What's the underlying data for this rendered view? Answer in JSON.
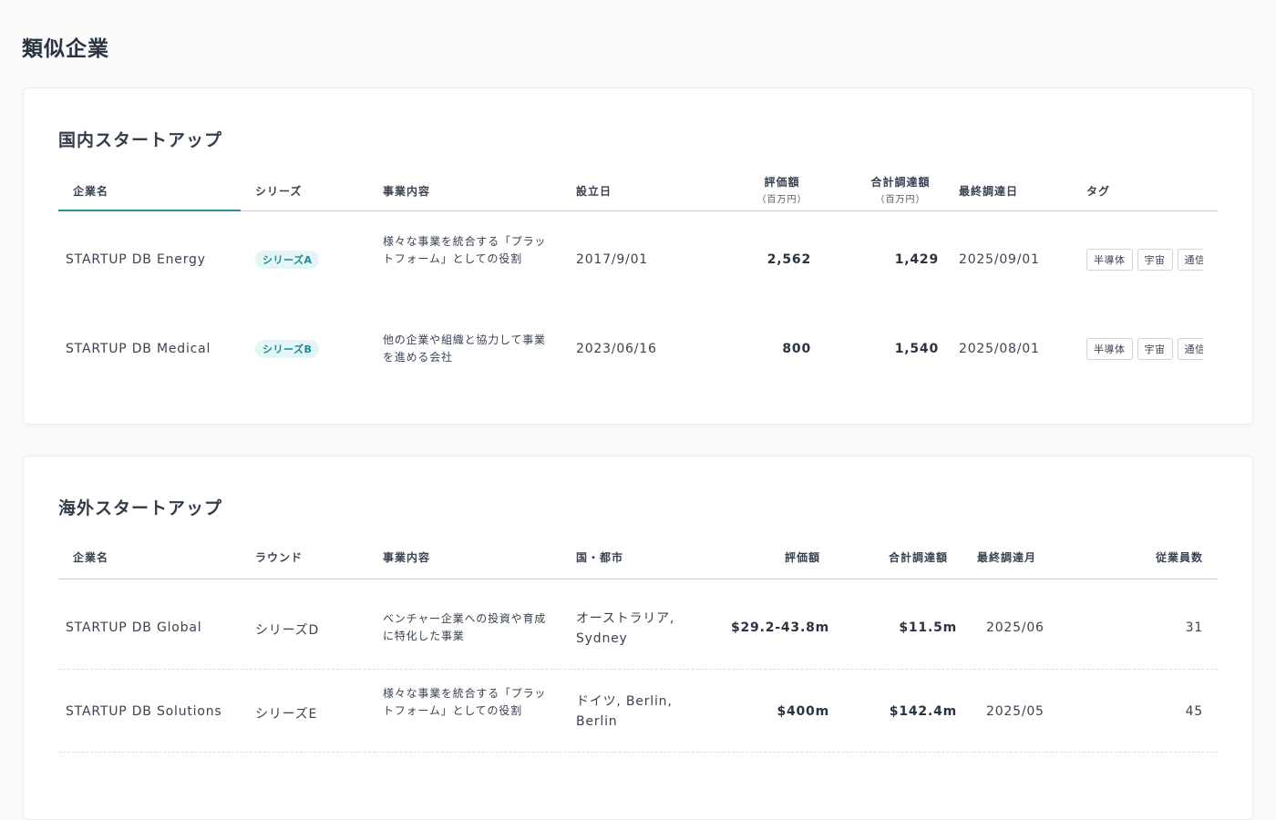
{
  "page": {
    "title": "類似企業"
  },
  "domestic": {
    "title": "国内スタートアップ",
    "headers": {
      "name": "企業名",
      "series": "シリーズ",
      "business": "事業内容",
      "founded": "設立日",
      "valuation": "評価額",
      "valuation_unit": "（百万円）",
      "total_funding": "合計調達額",
      "total_funding_unit": "（百万円）",
      "last_funding": "最終調達日",
      "tags": "タグ"
    },
    "rows": [
      {
        "name": "STARTUP DB Energy",
        "series": "シリーズA",
        "business": "様々な事業を統合する「プラットフォーム」としての役割",
        "founded": "2017/9/01",
        "valuation": "2,562",
        "total_funding": "1,429",
        "last_funding": "2025/09/01",
        "tags": [
          "半導体",
          "宇宙",
          "通信"
        ]
      },
      {
        "name": "STARTUP DB Medical",
        "series": "シリーズB",
        "business": "他の企業や組織と協力して事業を進める会社",
        "founded": "2023/06/16",
        "valuation": "800",
        "total_funding": "1,540",
        "last_funding": "2025/08/01",
        "tags": [
          "半導体",
          "宇宙",
          "通信"
        ]
      }
    ]
  },
  "overseas": {
    "title": "海外スタートアップ",
    "headers": {
      "name": "企業名",
      "round": "ラウンド",
      "business": "事業内容",
      "location": "国・都市",
      "valuation": "評価額",
      "total_funding": "合計調達額",
      "last_funding": "最終調達月",
      "employees": "従業員数"
    },
    "rows": [
      {
        "name": "STARTUP DB Global",
        "round": "シリーズD",
        "business": "ベンチャー企業への投資や育成に特化した事業",
        "location": "オーストラリア, Sydney",
        "valuation": "$29.2-43.8m",
        "total_funding": "$11.5m",
        "last_funding": "2025/06",
        "employees": "31"
      },
      {
        "name": "STARTUP DB Solutions",
        "round": "シリーズE",
        "business": "様々な事業を統合する「プラットフォーム」としての役割",
        "location": "ドイツ, Berlin, Berlin",
        "valuation": "$400m",
        "total_funding": "$142.4m",
        "last_funding": "2025/05",
        "employees": "45"
      }
    ]
  }
}
